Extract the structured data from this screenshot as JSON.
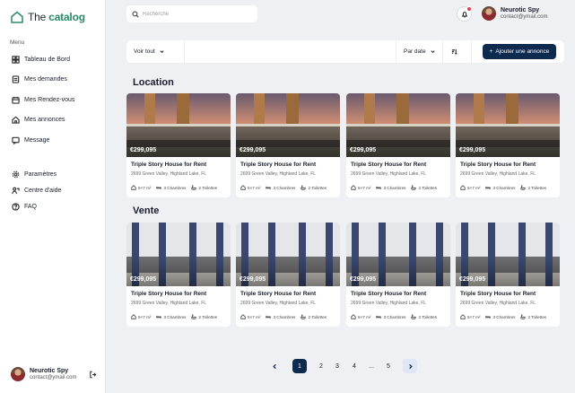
{
  "app": {
    "logo_prefix": "The ",
    "logo_bold": "catalog"
  },
  "sidebar": {
    "menu_title": "Menu",
    "items": [
      {
        "label": "Tableau de Bord",
        "icon": "dashboard-icon"
      },
      {
        "label": "Mes demandes",
        "icon": "document-icon"
      },
      {
        "label": "Mes Rendez-vous",
        "icon": "calendar-icon"
      },
      {
        "label": "Mes annonces",
        "icon": "house-icon"
      },
      {
        "label": "Message",
        "icon": "message-icon"
      }
    ],
    "bottom_items": [
      {
        "label": "Paramètres",
        "icon": "gear-icon"
      },
      {
        "label": "Centre d'aide",
        "icon": "help-center-icon"
      },
      {
        "label": "FAQ",
        "icon": "question-icon"
      }
    ],
    "profile": {
      "name": "Neurotic Spy",
      "email": "contact@ymail.com"
    }
  },
  "header": {
    "search_placeholder": "Recherche",
    "profile": {
      "name": "Neurotic Spy",
      "email": "contact@ymail.com"
    }
  },
  "filters": {
    "view_label": "Voir tout",
    "sort_label": "Par date",
    "add_button": "Ajouter une annonce"
  },
  "sections": [
    {
      "title": "Location",
      "cards": [
        {
          "price": "€299,095",
          "title": "Triple Story House for Rent",
          "address": "2699 Green Valley, Highland Lake, FL",
          "area": "5×7 m²",
          "rooms": "3 Chambres",
          "toilets": "2 Toilettes"
        },
        {
          "price": "€299,095",
          "title": "Triple Story House for Rent",
          "address": "2699 Green Valley, Highland Lake, FL",
          "area": "5×7 m²",
          "rooms": "3 Chambres",
          "toilets": "2 Toilettes"
        },
        {
          "price": "€299,095",
          "title": "Triple Story House for Rent",
          "address": "2699 Green Valley, Highland Lake, FL",
          "area": "5×7 m²",
          "rooms": "3 Chambres",
          "toilets": "2 Toilettes"
        },
        {
          "price": "€299,095",
          "title": "Triple Story House for Rent",
          "address": "2699 Green Valley, Highland Lake, FL",
          "area": "5×7 m²",
          "rooms": "3 Chambres",
          "toilets": "2 Toilettes"
        }
      ]
    },
    {
      "title": "Vente",
      "cards": [
        {
          "price": "€299,095",
          "title": "Triple Story House for Rent",
          "address": "2699 Green Valley, Highland Lake, FL",
          "area": "5×7 m²",
          "rooms": "3 Chambres",
          "toilets": "2 Toilettes"
        },
        {
          "price": "€299,095",
          "title": "Triple Story House for Rent",
          "address": "2699 Green Valley, Highland Lake, FL",
          "area": "5×7 m²",
          "rooms": "3 Chambres",
          "toilets": "2 Toilettes"
        },
        {
          "price": "€299,095",
          "title": "Triple Story House for Rent",
          "address": "2699 Green Valley, Highland Lake, FL",
          "area": "5×7 m²",
          "rooms": "3 Chambres",
          "toilets": "2 Toilettes"
        },
        {
          "price": "€299,095",
          "title": "Triple Story House for Rent",
          "address": "2699 Green Valley, Highland Lake, FL",
          "area": "5×7 m²",
          "rooms": "3 Chambres",
          "toilets": "2 Toilettes"
        }
      ]
    }
  ],
  "pagination": {
    "pages": [
      "1",
      "2",
      "3",
      "4",
      "...",
      "5"
    ],
    "current": "1"
  },
  "colors": {
    "primary": "#0f2a4f",
    "notification": "#e2394a",
    "background": "#eef0f4",
    "logo_accent": "#2a8a6a"
  }
}
